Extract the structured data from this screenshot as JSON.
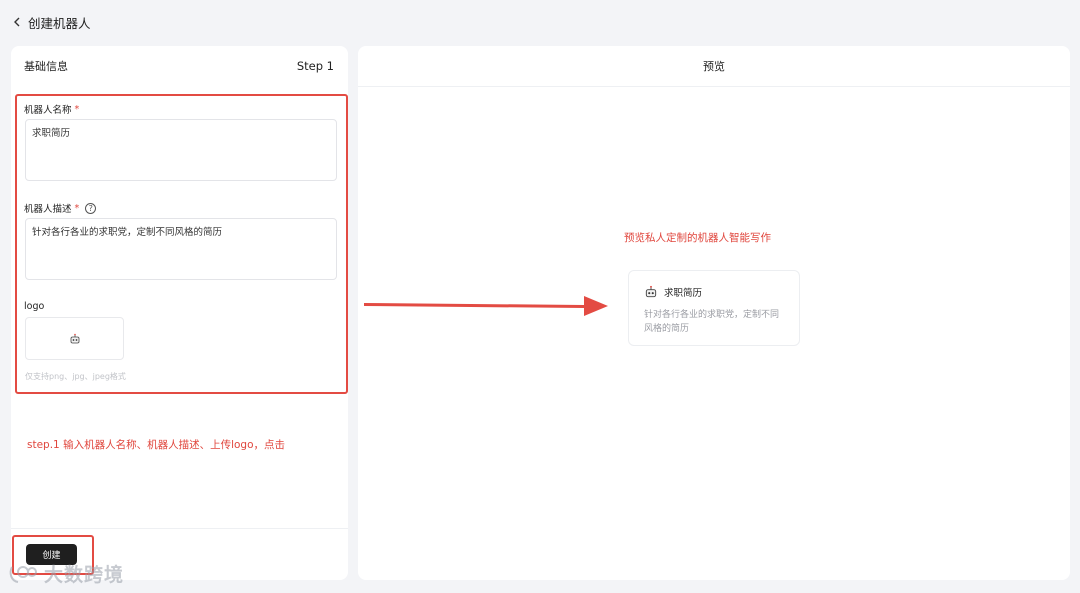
{
  "header": {
    "title": "创建机器人",
    "back_icon": "chevron-left-icon"
  },
  "left_panel": {
    "title": "基础信息",
    "step": "Step 1",
    "name_field": {
      "label": "机器人名称",
      "required_mark": "*",
      "value": "求职简历"
    },
    "desc_field": {
      "label": "机器人描述",
      "required_mark": "*",
      "help_icon": "question-circle-icon",
      "value": "针对各行各业的求职党，定制不同风格的简历"
    },
    "logo_field": {
      "label": "logo",
      "hint": "仅支持png、jpg、jpeg格式"
    },
    "step_note": "step.1 输入机器人名称、机器人描述、上传logo，点击",
    "create_button": "创建"
  },
  "right_panel": {
    "title": "预览",
    "note": "预览私人定制的机器人智能写作",
    "card": {
      "name": "求职简历",
      "desc": "针对各行各业的求职党，定制不同风格的简历"
    }
  },
  "watermark": {
    "text": "大数跨境"
  },
  "colors": {
    "annotation": "#e34b43",
    "accent_text": "#e0463d",
    "button_bg": "#1f1f1f"
  }
}
